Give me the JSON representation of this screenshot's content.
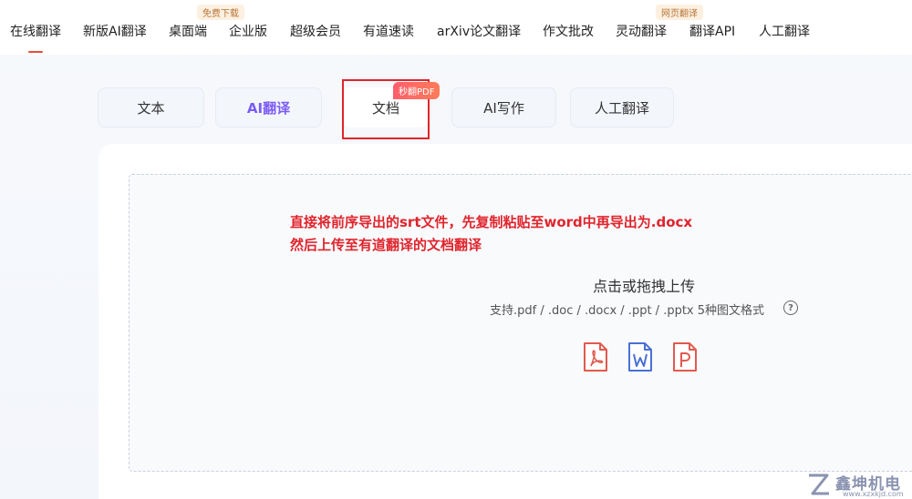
{
  "nav": {
    "items": [
      {
        "label": "在线翻译"
      },
      {
        "label": "新版AI翻译"
      },
      {
        "label": "桌面端",
        "badge": "免费下载"
      },
      {
        "label": "企业版"
      },
      {
        "label": "超级会员"
      },
      {
        "label": "有道速读"
      },
      {
        "label": "arXiv论文翻译"
      },
      {
        "label": "作文批改"
      },
      {
        "label": "灵动翻译",
        "badge": "网页翻译"
      },
      {
        "label": "翻译API"
      },
      {
        "label": "人工翻译"
      }
    ]
  },
  "tabs": {
    "items": [
      {
        "label": "文本"
      },
      {
        "label": "AI翻译"
      },
      {
        "label": "文档",
        "badge": "秒翻PDF"
      },
      {
        "label": "AI写作"
      },
      {
        "label": "人工翻译"
      }
    ]
  },
  "annotation": {
    "line1": "直接将前序导出的srt文件，先复制粘贴至word中再导出为.docx",
    "line2": "然后上传至有道翻译的文档翻译"
  },
  "upload": {
    "title": "点击或拖拽上传",
    "formats": "支持.pdf / .doc / .docx / .ppt / .pptx 5种图文格式",
    "help_glyph": "?"
  },
  "file_types": {
    "pdf_color": "#e05a4e",
    "word_color": "#4a6fd6",
    "ppt_color": "#e05a4e"
  },
  "watermark": {
    "text": "鑫坤机电",
    "url": "www.xzxkjd.com"
  }
}
